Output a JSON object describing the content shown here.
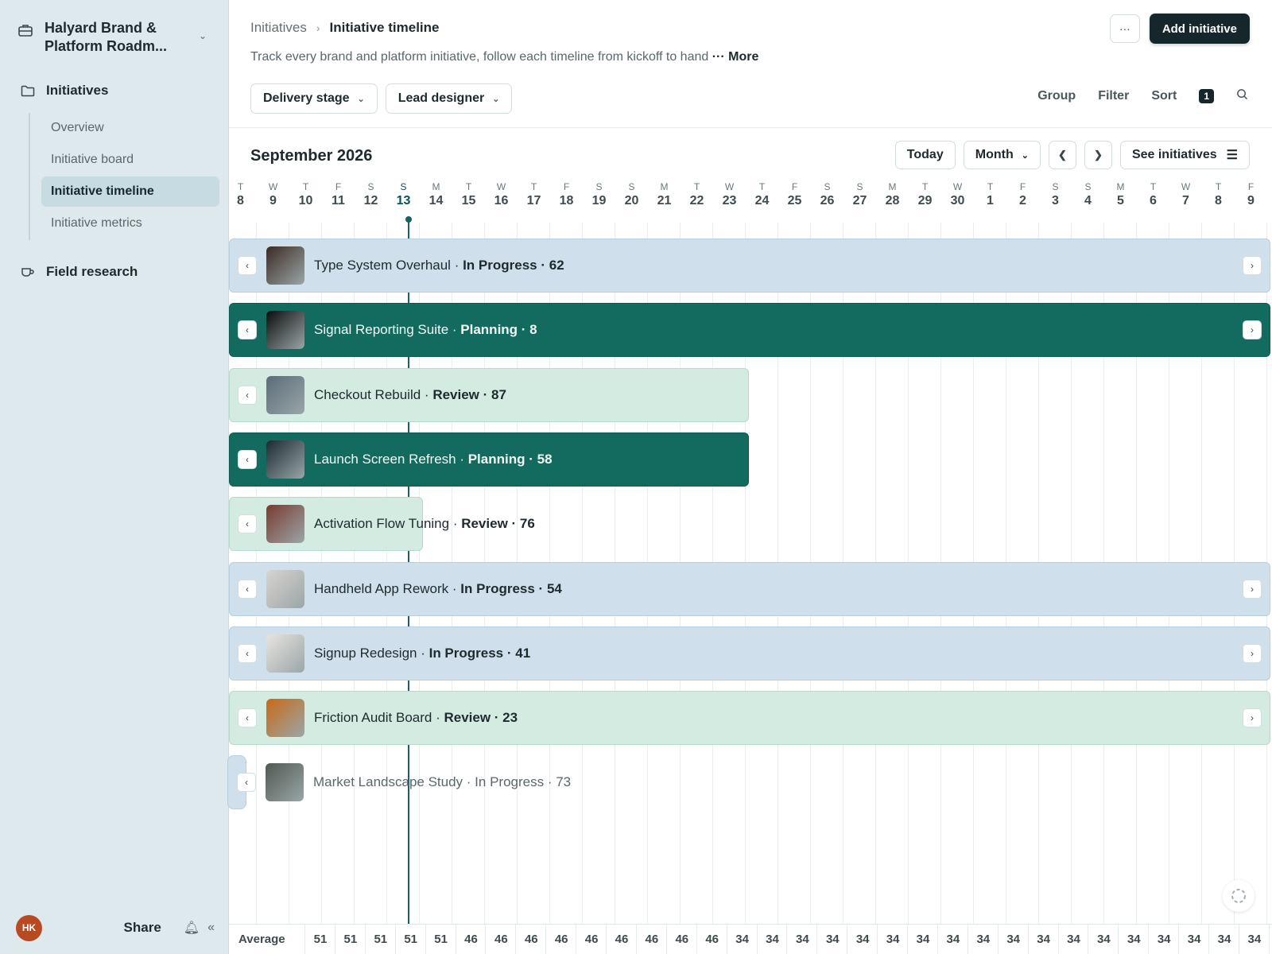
{
  "workspace": {
    "name": "Halyard Brand & Platform Roadm..."
  },
  "nav": {
    "initiatives": "Initiatives",
    "subitems": [
      "Overview",
      "Initiative board",
      "Initiative timeline",
      "Initiative metrics"
    ],
    "field_research": "Field research"
  },
  "sidebar_footer": {
    "avatar": "HK",
    "share": "Share"
  },
  "breadcrumb": {
    "parent": "Initiatives",
    "current": "Initiative timeline"
  },
  "header": {
    "more_button": "···",
    "add_button": "Add initiative",
    "description": "Track every brand and platform initiative, follow each timeline from kickoff to hand",
    "description_more": "··· More"
  },
  "filters": {
    "delivery_stage": "Delivery stage",
    "lead_designer": "Lead designer"
  },
  "views": {
    "group": "Group",
    "filter": "Filter",
    "sort": "Sort",
    "sort_count": "1"
  },
  "timeline": {
    "month_label": "September 2026",
    "today": "Today",
    "period": "Month",
    "see_initiatives": "See initiatives",
    "days": [
      {
        "wd": "T",
        "d": "8"
      },
      {
        "wd": "W",
        "d": "9"
      },
      {
        "wd": "T",
        "d": "10"
      },
      {
        "wd": "F",
        "d": "11"
      },
      {
        "wd": "S",
        "d": "12"
      },
      {
        "wd": "S",
        "d": "13",
        "today": true
      },
      {
        "wd": "M",
        "d": "14"
      },
      {
        "wd": "T",
        "d": "15"
      },
      {
        "wd": "W",
        "d": "16"
      },
      {
        "wd": "T",
        "d": "17"
      },
      {
        "wd": "F",
        "d": "18"
      },
      {
        "wd": "S",
        "d": "19"
      },
      {
        "wd": "S",
        "d": "20"
      },
      {
        "wd": "M",
        "d": "21"
      },
      {
        "wd": "T",
        "d": "22"
      },
      {
        "wd": "W",
        "d": "23"
      },
      {
        "wd": "T",
        "d": "24"
      },
      {
        "wd": "F",
        "d": "25"
      },
      {
        "wd": "S",
        "d": "26"
      },
      {
        "wd": "S",
        "d": "27"
      },
      {
        "wd": "M",
        "d": "28"
      },
      {
        "wd": "T",
        "d": "29"
      },
      {
        "wd": "W",
        "d": "30"
      },
      {
        "wd": "T",
        "d": "1"
      },
      {
        "wd": "F",
        "d": "2"
      },
      {
        "wd": "S",
        "d": "3"
      },
      {
        "wd": "S",
        "d": "4"
      },
      {
        "wd": "M",
        "d": "5"
      },
      {
        "wd": "T",
        "d": "6"
      },
      {
        "wd": "W",
        "d": "7"
      },
      {
        "wd": "T",
        "d": "8"
      },
      {
        "wd": "F",
        "d": "9"
      }
    ],
    "initiatives": [
      {
        "name": "Type System Overhaul",
        "status": "In Progress",
        "score": "62",
        "style": "blue",
        "thumb": "#3b2a22"
      },
      {
        "name": "Signal Reporting Suite",
        "status": "Planning",
        "score": "8",
        "style": "dark",
        "thumb": "#0b0b0b"
      },
      {
        "name": "Checkout Rebuild",
        "status": "Review",
        "score": "87",
        "style": "mint",
        "thumb": "#5a6c7a"
      },
      {
        "name": "Launch Screen Refresh",
        "status": "Planning",
        "score": "58",
        "style": "dark",
        "thumb": "#1a2a32"
      },
      {
        "name": "Activation Flow Tuning",
        "status": "Review",
        "score": "76",
        "style": "mint",
        "thumb": "#7a3a30"
      },
      {
        "name": "Handheld App Rework",
        "status": "In Progress",
        "score": "54",
        "style": "blue",
        "thumb": "#d9d4cf"
      },
      {
        "name": "Signup Redesign",
        "status": "In Progress",
        "score": "41",
        "style": "blue",
        "thumb": "#e8e4df"
      },
      {
        "name": "Friction Audit Board",
        "status": "Review",
        "score": "23",
        "style": "mint",
        "thumb": "#c86a16"
      },
      {
        "name": "Market Landscape Study",
        "status": "In Progress",
        "score": "73",
        "style": "none",
        "thumb": "#4f5a52"
      }
    ]
  },
  "footer": {
    "average_label": "Average",
    "averages": [
      "51",
      "51",
      "51",
      "51",
      "51",
      "46",
      "46",
      "46",
      "46",
      "46",
      "46",
      "46",
      "46",
      "46",
      "34",
      "34",
      "34",
      "34",
      "34",
      "34",
      "34",
      "34",
      "34",
      "34",
      "34",
      "34",
      "34",
      "34",
      "34",
      "34",
      "34",
      "34",
      "34"
    ]
  },
  "colors": {
    "accent": "#16272c",
    "today_line": "#1e5f67",
    "bar_blue": "#cfe0ec",
    "bar_dark": "#136b60",
    "bar_mint": "#d3ebe1"
  }
}
